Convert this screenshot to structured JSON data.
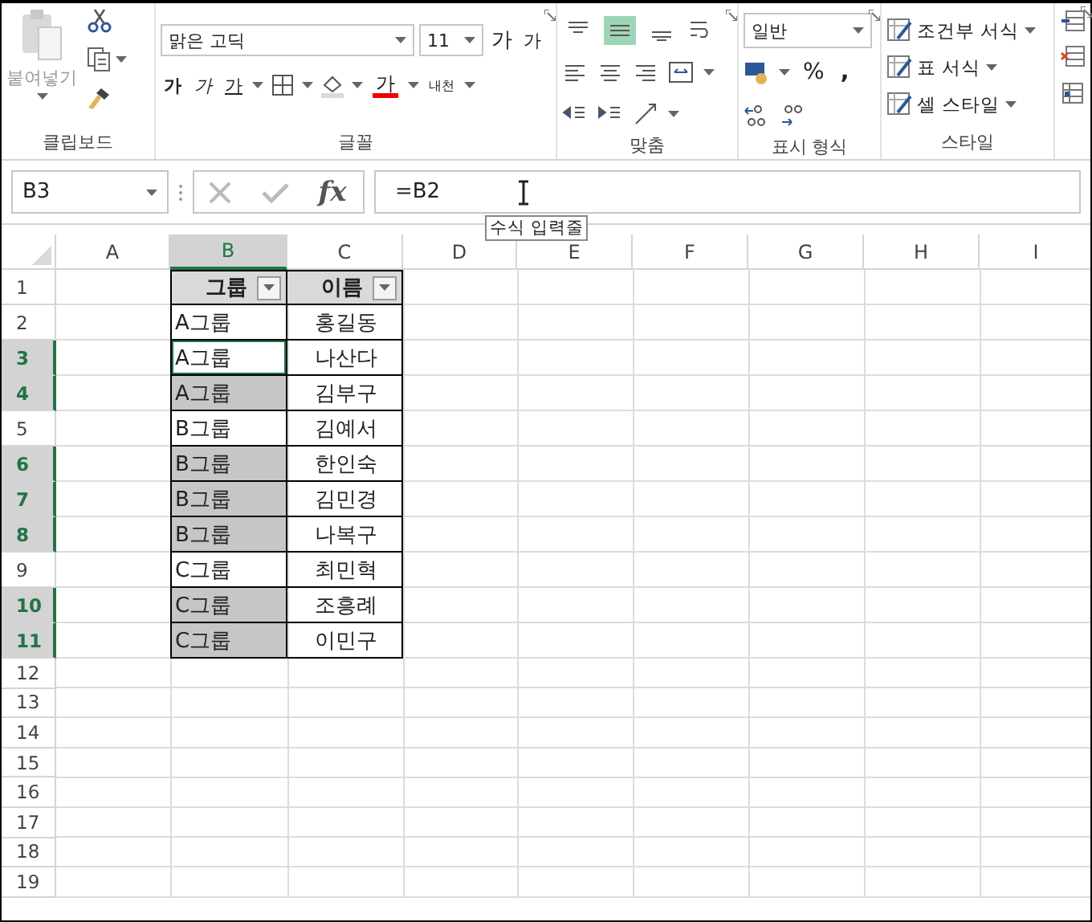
{
  "ribbon": {
    "clipboard": {
      "paste": "붙여넣기",
      "label": "클립보드"
    },
    "font": {
      "name": "맑은 고딕",
      "size": "11",
      "grow": "가",
      "shrink": "가",
      "bold": "가",
      "italic": "가",
      "underline": "가",
      "font_color": "가",
      "phonetic": "내천",
      "label": "글꼴"
    },
    "alignment": {
      "vertical": [
        {
          "selected": false
        },
        {
          "selected": true
        },
        {
          "selected": false
        }
      ],
      "label": "맞춤"
    },
    "number": {
      "format": "일반",
      "percent": "%",
      "comma": ",",
      "label": "표시 형식"
    },
    "styles": {
      "items": [
        "조건부 서식",
        "표 서식",
        "셀 스타일"
      ],
      "label": "스타일"
    }
  },
  "formula_bar": {
    "name_box": "B3",
    "function_glyph": "fx",
    "formula": "=B2",
    "tooltip": "수식 입력줄"
  },
  "sheet": {
    "columns": [
      {
        "label": "A",
        "selected": false
      },
      {
        "label": "B",
        "selected": true
      },
      {
        "label": "C",
        "selected": false
      },
      {
        "label": "D",
        "selected": false
      },
      {
        "label": "E",
        "selected": false
      },
      {
        "label": "F",
        "selected": false
      },
      {
        "label": "G",
        "selected": false
      },
      {
        "label": "H",
        "selected": false
      },
      {
        "label": "I",
        "selected": false
      }
    ],
    "rows": [
      {
        "number": "1",
        "selected": false
      },
      {
        "number": "2",
        "selected": false
      },
      {
        "number": "3",
        "selected": true
      },
      {
        "number": "4",
        "selected": true
      },
      {
        "number": "5",
        "selected": false
      },
      {
        "number": "6",
        "selected": true
      },
      {
        "number": "7",
        "selected": true
      },
      {
        "number": "8",
        "selected": true
      },
      {
        "number": "9",
        "selected": false
      },
      {
        "number": "10",
        "selected": true
      },
      {
        "number": "11",
        "selected": true
      },
      {
        "number": "12",
        "selected": false
      },
      {
        "number": "13",
        "selected": false
      },
      {
        "number": "14",
        "selected": false
      },
      {
        "number": "15",
        "selected": false
      },
      {
        "number": "16",
        "selected": false
      },
      {
        "number": "17",
        "selected": false
      },
      {
        "number": "18",
        "selected": false
      },
      {
        "number": "19",
        "selected": false
      }
    ],
    "table": {
      "headers": [
        "그룹",
        "이름"
      ],
      "rows": [
        {
          "group": "A그룹",
          "name": "홍길동",
          "selected": false,
          "active": false
        },
        {
          "group": "A그룹",
          "name": "나산다",
          "selected": true,
          "active": true
        },
        {
          "group": "A그룹",
          "name": "김부구",
          "selected": true,
          "active": false
        },
        {
          "group": "B그룹",
          "name": "김예서",
          "selected": false,
          "active": false
        },
        {
          "group": "B그룹",
          "name": "한인숙",
          "selected": true,
          "active": false
        },
        {
          "group": "B그룹",
          "name": "김민경",
          "selected": true,
          "active": false
        },
        {
          "group": "B그룹",
          "name": "나복구",
          "selected": true,
          "active": false
        },
        {
          "group": "C그룹",
          "name": "최민혁",
          "selected": false,
          "active": false
        },
        {
          "group": "C그룹",
          "name": "조흥례",
          "selected": true,
          "active": false
        },
        {
          "group": "C그룹",
          "name": "이민구",
          "selected": true,
          "active": false
        }
      ]
    }
  }
}
